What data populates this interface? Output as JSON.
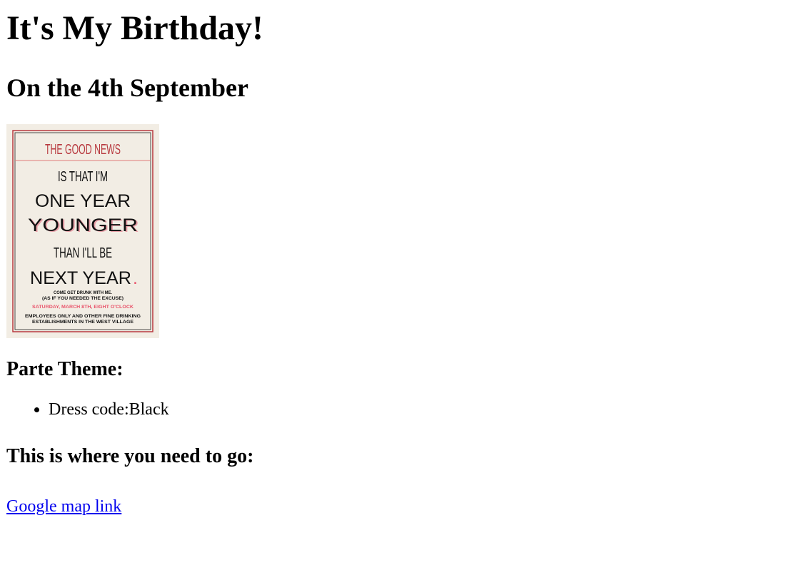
{
  "page": {
    "title": "It's My Birthday!",
    "subtitle": "On the 4th September"
  },
  "poster": {
    "line1": "THE GOOD NEWS",
    "line2": "IS THAT I'M",
    "line3": "ONE YEAR",
    "line4": "YOUNGER",
    "line5": "THAN I'LL BE",
    "line6": "NEXT YEAR",
    "line6_period": ".",
    "small1": "COME GET DRUNK WITH ME.",
    "small2": "(AS IF YOU NEEDED THE EXCUSE)",
    "date_line": "SATURDAY, MARCH 8TH, EIGHT O'CLOCK",
    "venue1": "EMPLOYEES ONLY AND OTHER FINE DRINKING",
    "venue2": "ESTABLISHMENTS IN THE WEST VILLAGE",
    "colors": {
      "background": "#f2ede4",
      "border": "#b8393f",
      "accent": "#c0392b",
      "text": "#111111",
      "pink": "#e9546b"
    }
  },
  "theme": {
    "heading": "Parte Theme:",
    "items": [
      "Dress code:Black"
    ]
  },
  "location": {
    "heading": "This is where you need to go:",
    "link_text": "Google map link"
  },
  "colors": {
    "link": "#0000ee",
    "text": "#000000"
  }
}
